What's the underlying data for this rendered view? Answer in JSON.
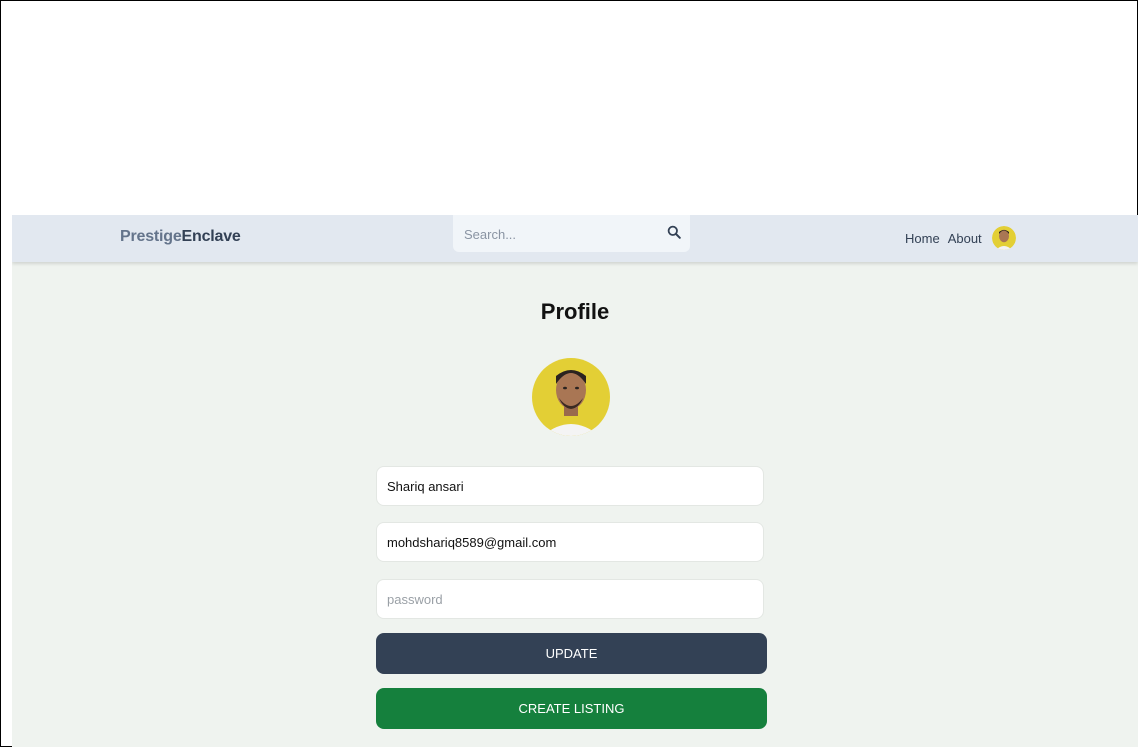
{
  "navbar": {
    "brand_part1": "Prestige",
    "brand_part2": "Enclave",
    "search_placeholder": "Search...",
    "search_value": "",
    "links": [
      {
        "label": "Home"
      },
      {
        "label": "About"
      }
    ]
  },
  "profile": {
    "title": "Profile",
    "username": "Shariq ansari",
    "email": "mohdshariq8589@gmail.com",
    "password_placeholder": "password",
    "password_value": "",
    "update_label": "UPDATE",
    "create_listing_label": "CREATE LISTING"
  },
  "colors": {
    "navbar_bg": "#e2e8f0",
    "page_bg": "#eff3ef",
    "update_button": "#334155",
    "create_listing_button": "#15803d",
    "avatar_bg": "#e3cf35"
  },
  "icons": {
    "search": "search-icon",
    "avatar": "user-avatar"
  }
}
